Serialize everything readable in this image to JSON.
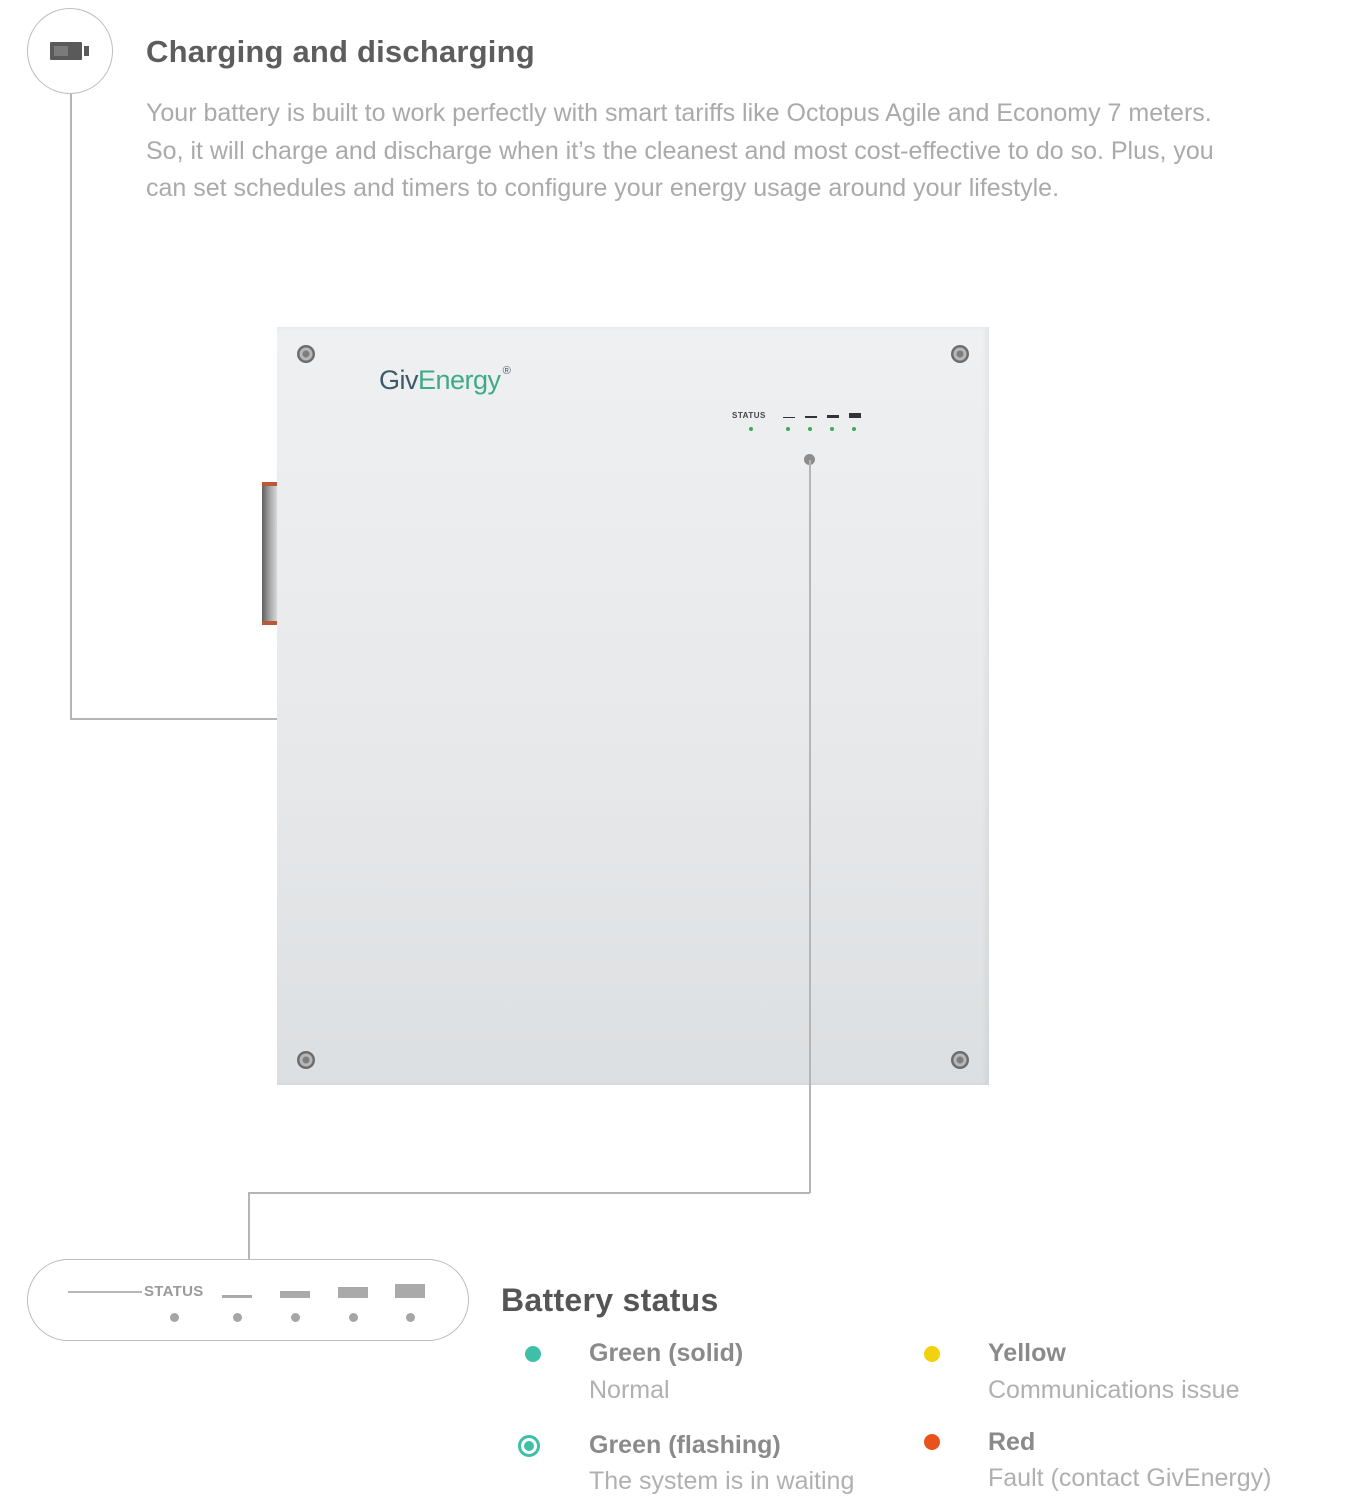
{
  "header": {
    "icon": "battery-icon",
    "title": "Charging and discharging",
    "description": "Your battery is built to work perfectly with smart tariffs like Octopus Agile and Economy 7 meters. So, it will charge and discharge when it’s the cleanest and most cost-effective to do so. Plus, you can set schedules and timers to configure your energy usage around your lifestyle."
  },
  "unit": {
    "brand_prefix": "Giv",
    "brand_suffix": "Energy",
    "brand_mark": "®",
    "status_label": "STATUS"
  },
  "status_panel": {
    "label": "STATUS"
  },
  "legend": {
    "title": "Battery status",
    "items": [
      {
        "name": "Green (solid)",
        "description": "Normal",
        "color": "#3ebfa8",
        "style": "solid"
      },
      {
        "name": "Green (flashing)",
        "description": "The system is in waiting",
        "color": "#3ebfa8",
        "style": "flashing"
      },
      {
        "name": "Yellow",
        "description": "Communications issue",
        "color": "#f2d20f",
        "style": "solid"
      },
      {
        "name": "Red",
        "description": "Fault (contact GivEnergy)",
        "color": "#e8521c",
        "style": "solid"
      }
    ]
  }
}
